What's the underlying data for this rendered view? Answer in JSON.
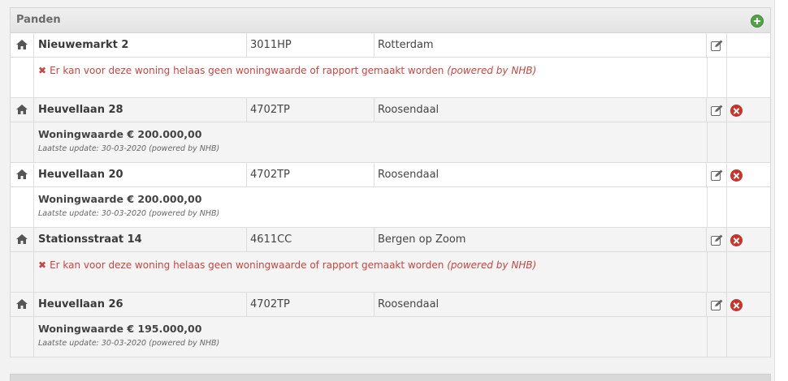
{
  "panel": {
    "title": "Panden"
  },
  "entries": [
    {
      "street": "Nieuwemarkt 2",
      "zip": "3011HP",
      "city": "Rotterdam",
      "has_delete": false,
      "detail": {
        "type": "error",
        "x": "✖",
        "message": "Er kan voor deze woning helaas geen woningwaarde of rapport gemaakt worden",
        "powered": "(powered by NHB)"
      }
    },
    {
      "street": "Heuvellaan 28",
      "zip": "4702TP",
      "city": "Roosendaal",
      "has_delete": true,
      "detail": {
        "type": "value",
        "value": "Woningwaarde € 200.000,00",
        "update": "Laatste update: 30-03-2020 (powered by NHB)"
      }
    },
    {
      "street": "Heuvellaan 20",
      "zip": "4702TP",
      "city": "Roosendaal",
      "has_delete": true,
      "detail": {
        "type": "value",
        "value": "Woningwaarde € 200.000,00",
        "update": "Laatste update: 30-03-2020 (powered by NHB)"
      }
    },
    {
      "street": "Stationsstraat 14",
      "zip": "4611CC",
      "city": "Bergen op Zoom",
      "has_delete": true,
      "detail": {
        "type": "error",
        "x": "✖",
        "message": "Er kan voor deze woning helaas geen woningwaarde of rapport gemaakt worden",
        "powered": "(powered by NHB)"
      }
    },
    {
      "street": "Heuvellaan 26",
      "zip": "4702TP",
      "city": "Roosendaal",
      "has_delete": true,
      "detail": {
        "type": "value",
        "value": "Woningwaarde € 195.000,00",
        "update": "Laatste update: 30-03-2020 (powered by NHB)"
      }
    }
  ],
  "colors": {
    "accent_green": "#52a447",
    "delete_red": "#c8332b",
    "error_text": "#c9453f"
  },
  "icons": {
    "row": "home-icon",
    "edit": "edit-icon",
    "delete": "delete-icon",
    "add": "add-icon"
  }
}
